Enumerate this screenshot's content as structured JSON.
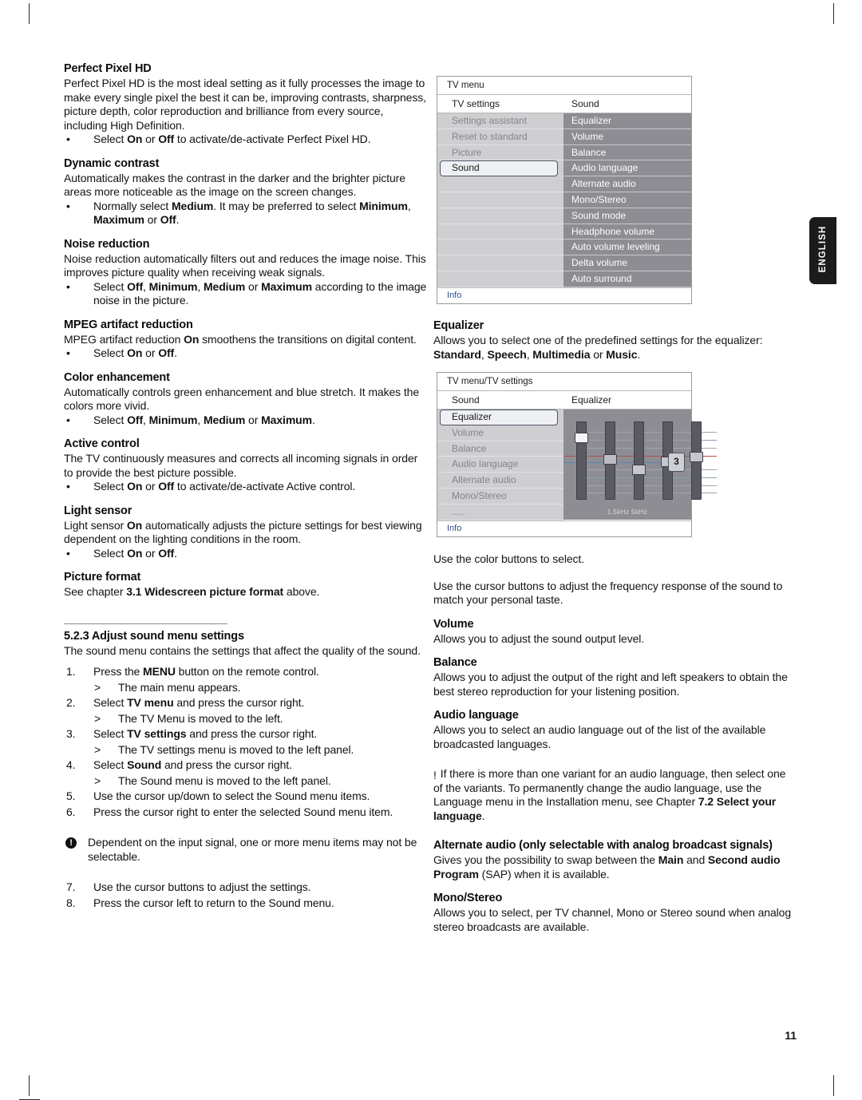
{
  "page": {
    "number": "11",
    "language_tab": "ENGLISH"
  },
  "left_column": {
    "sections": [
      {
        "heading": "Perfect Pixel HD",
        "paragraph": "Perfect Pixel HD is the most ideal setting as it fully processes the image to make every single pixel the best it can be, improving contrasts, sharpness, picture depth, color reproduction and brilliance from every source, including High Definition.",
        "bullets": [
          "Select <b>On</b> or <b>Off</b> to activate/de-activate Perfect Pixel HD."
        ]
      },
      {
        "heading": "Dynamic contrast",
        "paragraph": "Automatically makes the contrast in the darker and the brighter picture areas more noticeable as the image on the screen changes.",
        "bullets": [
          "Normally select <b>Medium</b>. It may be preferred to select <b>Minimum</b>, <b>Maximum</b> or <b>Off</b>."
        ]
      },
      {
        "heading": "Noise reduction",
        "paragraph": "Noise reduction automatically filters out and reduces the image noise. This improves picture quality when receiving weak signals.",
        "bullets": [
          "Select <b>Off</b>, <b>Minimum</b>, <b>Medium</b> or <b>Maximum</b> according to the image noise in the picture."
        ]
      },
      {
        "heading": "MPEG artifact reduction",
        "paragraph": "MPEG artifact reduction <b>On</b> smoothens the transitions on digital content.",
        "bullets": [
          "Select <b>On</b> or <b>Off</b>."
        ]
      },
      {
        "heading": "Color enhancement",
        "paragraph": "Automatically controls green enhancement and blue stretch. It makes the colors more vivid.",
        "bullets": [
          "Select <b>Off</b>, <b>Minimum</b>, <b>Medium</b> or <b>Maximum</b>."
        ]
      },
      {
        "heading": "Active control",
        "paragraph": "The TV continuously measures and corrects all incoming signals in order to provide the best picture possible.",
        "bullets": [
          "Select <b>On</b> or <b>Off</b> to activate/de-activate Active control."
        ]
      },
      {
        "heading": "Light sensor",
        "paragraph": "Light sensor <b>On</b> automatically adjusts the picture settings for best viewing dependent on the lighting conditions in the room.",
        "bullets": [
          "Select <b>On</b> or <b>Off</b>."
        ]
      },
      {
        "heading": "Picture format",
        "paragraph": "See chapter <b>3.1 Widescreen picture format</b> above.",
        "bullets": []
      }
    ],
    "subsection": {
      "heading": "5.2.3 Adjust sound menu settings",
      "paragraph": "The sound menu contains the settings that affect the quality of the sound.",
      "steps": [
        {
          "type": "num",
          "n": "1.",
          "text": "Press the <b>MENU</b> button on the remote control."
        },
        {
          "type": "sub",
          "text": "The main menu appears."
        },
        {
          "type": "num",
          "n": "2.",
          "text": "Select <b>TV menu</b> and press the cursor right."
        },
        {
          "type": "sub",
          "text": "The TV Menu is moved to the left."
        },
        {
          "type": "num",
          "n": "3.",
          "text": "Select <b>TV settings</b> and press the cursor right."
        },
        {
          "type": "sub",
          "text": "The TV settings menu is moved to the left panel."
        },
        {
          "type": "num",
          "n": "4.",
          "text": "Select <b>Sound</b> and press the cursor right."
        },
        {
          "type": "sub",
          "text": "The Sound menu is moved to the left panel."
        },
        {
          "type": "num",
          "n": "5.",
          "text": "Use the cursor up/down to select the Sound menu items."
        },
        {
          "type": "num",
          "n": "6.",
          "text": "Press the cursor right to enter the selected Sound menu item."
        }
      ],
      "note": "Dependent on the input signal, one or more menu items may not be selectable.",
      "steps_after": [
        {
          "type": "num",
          "n": "7.",
          "text": "Use the cursor buttons to adjust the settings."
        },
        {
          "type": "num",
          "n": "8.",
          "text": "Press the cursor left to return to the Sound menu."
        }
      ]
    }
  },
  "osd_tv_menu": {
    "title": "TV menu",
    "col1_header": "TV settings",
    "col2_header": "Sound",
    "left_items": [
      "Settings assistant",
      "Reset to standard",
      "Picture"
    ],
    "selected_item": "Sound",
    "right_items": [
      "Equalizer",
      "Volume",
      "Balance",
      "Audio language",
      "Alternate audio",
      "Mono/Stereo",
      "Sound mode",
      "Headphone volume",
      "Auto volume leveling",
      "Delta volume",
      "Auto surround"
    ],
    "info_label": "Info"
  },
  "osd_equalizer": {
    "title": "TV menu/TV settings",
    "col1_header": "Sound",
    "col2_header": "Equalizer",
    "selected_item": "Equalizer",
    "left_items": [
      "Volume",
      "Balance",
      "Audio language",
      "Alternate audio",
      "Mono/Stereo",
      "....."
    ],
    "value": "3",
    "freq_labels": "1,5kHz 5kHz",
    "info_label": "Info",
    "slider_levels": [
      82,
      55,
      42,
      52,
      58
    ]
  },
  "right_column": {
    "sections": [
      {
        "heading": "Equalizer",
        "paragraph": "Allows you to select one of the predefined settings for the equalizer: <b>Standard</b>, <b>Speech</b>, <b>Multimedia</b> or <b>Music</b>."
      },
      {
        "heading": "",
        "paragraph": "Use the color buttons to select."
      },
      {
        "heading": "",
        "paragraph": "Use the cursor buttons to adjust the frequency response of the sound to match your personal taste."
      },
      {
        "heading": "Volume",
        "paragraph": "Allows you to adjust the sound output level."
      },
      {
        "heading": "Balance",
        "paragraph": "Allows you to adjust the output of the right and left speakers to obtain the best stereo reproduction for your listening position."
      },
      {
        "heading": "Audio language",
        "paragraph": "Allows you to select an audio language out of the list of the available broadcasted languages."
      }
    ],
    "note": "If there is more than one variant for an audio language, then select one of the variants. To permanently change the audio language, use the Language menu in the Installation menu, see Chapter <b>7.2 Select your language</b>.",
    "sections_after": [
      {
        "heading": "Alternate audio (only selectable with analog broadcast signals)",
        "paragraph": "Gives you the possibility to swap between the <b>Main</b> and <b>Second audio Program</b> (SAP) when it is available."
      },
      {
        "heading": "Mono/Stereo",
        "paragraph": "Allows you to select, per TV channel, Mono or Stereo sound when analog stereo broadcasts are available."
      }
    ]
  }
}
